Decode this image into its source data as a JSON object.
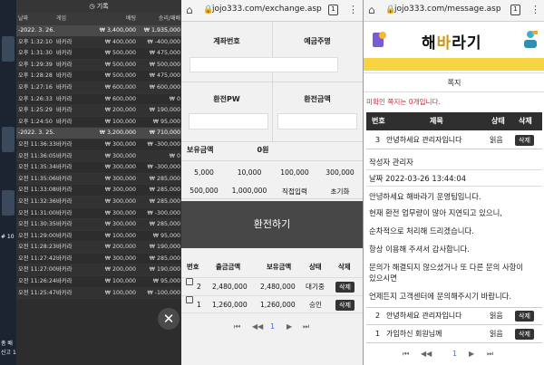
{
  "history": {
    "title": "기록",
    "columns": [
      "날짜",
      "게임",
      "배팅",
      "승리/패배"
    ],
    "rows": [
      {
        "type": "date",
        "time": "-2022. 3. 26.",
        "game": "",
        "bet": "₩ 3,400,000",
        "win": "₩ 1,935,000"
      },
      {
        "type": "row",
        "time": "오후 1:32:10",
        "game": "바카라",
        "bet": "₩ 400,000",
        "win": "₩ -400,000"
      },
      {
        "type": "row",
        "time": "오후 1:31:30",
        "game": "바카라",
        "bet": "₩ 500,000",
        "win": "₩ 475,000"
      },
      {
        "type": "row",
        "time": "오후 1:29:39",
        "game": "바카라",
        "bet": "₩ 500,000",
        "win": "₩ 500,000"
      },
      {
        "type": "row",
        "time": "오후 1:28:28",
        "game": "바카라",
        "bet": "₩ 500,000",
        "win": "₩ 475,000"
      },
      {
        "type": "row",
        "time": "오후 1:27:16",
        "game": "바카라",
        "bet": "₩ 600,000",
        "win": "₩ 600,000"
      },
      {
        "type": "row",
        "time": "오후 1:26:33",
        "game": "바카라",
        "bet": "₩ 600,000",
        "win": "₩ 0"
      },
      {
        "type": "row",
        "time": "오후 1:25:29",
        "game": "바카라",
        "bet": "₩ 200,000",
        "win": "₩ 190,000"
      },
      {
        "type": "row",
        "time": "오후 1:24:50",
        "game": "바카라",
        "bet": "₩ 100,000",
        "win": "₩ 95,000"
      },
      {
        "type": "date",
        "time": "-2022. 3. 25.",
        "game": "",
        "bet": "₩ 3,200,000",
        "win": "₩ 710,000"
      },
      {
        "type": "row",
        "time": "오전 11:36:33",
        "game": "바카라",
        "bet": "₩ 300,000",
        "win": "₩ -300,000"
      },
      {
        "type": "row",
        "time": "오전 11:36:05",
        "game": "바카라",
        "bet": "₩ 300,000",
        "win": "₩ 0"
      },
      {
        "type": "row",
        "time": "오전 11:35:34",
        "game": "바카라",
        "bet": "₩ 300,000",
        "win": "₩ -300,000"
      },
      {
        "type": "row",
        "time": "오전 11:35:06",
        "game": "바카라",
        "bet": "₩ 300,000",
        "win": "₩ 285,000"
      },
      {
        "type": "row",
        "time": "오전 11:33:08",
        "game": "바카라",
        "bet": "₩ 300,000",
        "win": "₩ 285,000"
      },
      {
        "type": "row",
        "time": "오전 11:32:36",
        "game": "바카라",
        "bet": "₩ 300,000",
        "win": "₩ 285,000"
      },
      {
        "type": "row",
        "time": "오전 11:31:00",
        "game": "바카라",
        "bet": "₩ 300,000",
        "win": "₩ -300,000"
      },
      {
        "type": "row",
        "time": "오전 11:30:35",
        "game": "바카라",
        "bet": "₩ 300,000",
        "win": "₩ 285,000"
      },
      {
        "type": "row",
        "time": "오전 11:29:00",
        "game": "바카라",
        "bet": "₩ 100,000",
        "win": "₩ 95,000"
      },
      {
        "type": "row",
        "time": "오전 11:28:23",
        "game": "바카라",
        "bet": "₩ 200,000",
        "win": "₩ 190,000"
      },
      {
        "type": "row",
        "time": "오전 11:27:42",
        "game": "바카라",
        "bet": "₩ 300,000",
        "win": "₩ 285,000"
      },
      {
        "type": "row",
        "time": "오전 11:27:00",
        "game": "바카라",
        "bet": "₩ 200,000",
        "win": "₩ 190,000"
      },
      {
        "type": "row",
        "time": "오전 11:26:24",
        "game": "바카라",
        "bet": "₩ 100,000",
        "win": "₩ 95,000"
      },
      {
        "type": "row",
        "time": "오전 11:25:47",
        "game": "바카라",
        "bet": "₩ 100,000",
        "win": "₩ -100,000"
      }
    ],
    "side_texts": [
      "# 10",
      "총 배",
      "신고 1"
    ],
    "close_label": "✕"
  },
  "exchange": {
    "url": "jojo333.com/exchange.asp",
    "tab_count": "1",
    "labels": {
      "account": "계좌번호",
      "holder": "예금주명",
      "pw": "환전PW",
      "amount": "환전금액",
      "balance": "보유금액",
      "balance_value": "0원"
    },
    "amount_buttons": [
      "5,000",
      "10,000",
      "100,000",
      "300,000",
      "500,000",
      "1,000,000",
      "직접입력",
      "초기화"
    ],
    "submit_label": "환전하기",
    "table": {
      "headers": [
        "번호",
        "출금금액",
        "보유금액",
        "상태",
        "삭제"
      ],
      "rows": [
        {
          "no": "2",
          "withdraw": "2,480,000",
          "holding": "2,480,000",
          "status": "대기중",
          "del": "삭제"
        },
        {
          "no": "1",
          "withdraw": "1,260,000",
          "holding": "1,260,000",
          "status": "승인",
          "del": "삭제"
        }
      ]
    },
    "pager": {
      "first": "⏮",
      "prev": "◀◀",
      "current": "1",
      "next": "▶",
      "last": "⏭"
    }
  },
  "message": {
    "url": "jojo333.com/message.asp",
    "logo": "해바라기",
    "page_title": "쪽지",
    "unread": "미확인 쪽지는 0개입니다.",
    "table": {
      "headers": [
        "번호",
        "제목",
        "상태",
        "삭제"
      ],
      "rows": [
        {
          "no": "3",
          "title": "안녕하세요 관리자입니다",
          "status": "읽음",
          "del": "삭제"
        },
        {
          "no": "2",
          "title": "안녕하세요 관리자입니다",
          "status": "읽음",
          "del": "삭제"
        },
        {
          "no": "1",
          "title": "가입하신 회원님께",
          "status": "읽음",
          "del": "삭제"
        }
      ]
    },
    "detail": {
      "author": "작성자 관리자",
      "date": "날짜 2022-03-26 13:44:04",
      "body": [
        "안녕하세요 해바라기 운영팀입니다.",
        "현재 환전 업무량이 많아 지연되고 있으니,",
        "순차적으로 처리해 드리겠습니다.",
        "항상 이용해 주셔서 감사합니다.",
        "문의가 해결되지 않으셨거나 또 다른 문의 사항이",
        "있으시면",
        "언제든지 고객센터에 문의해주시기 바랍니다."
      ]
    },
    "pager": {
      "first": "⏮",
      "prev": "◀◀",
      "current": "1",
      "next": "▶",
      "last": "⏭"
    }
  }
}
